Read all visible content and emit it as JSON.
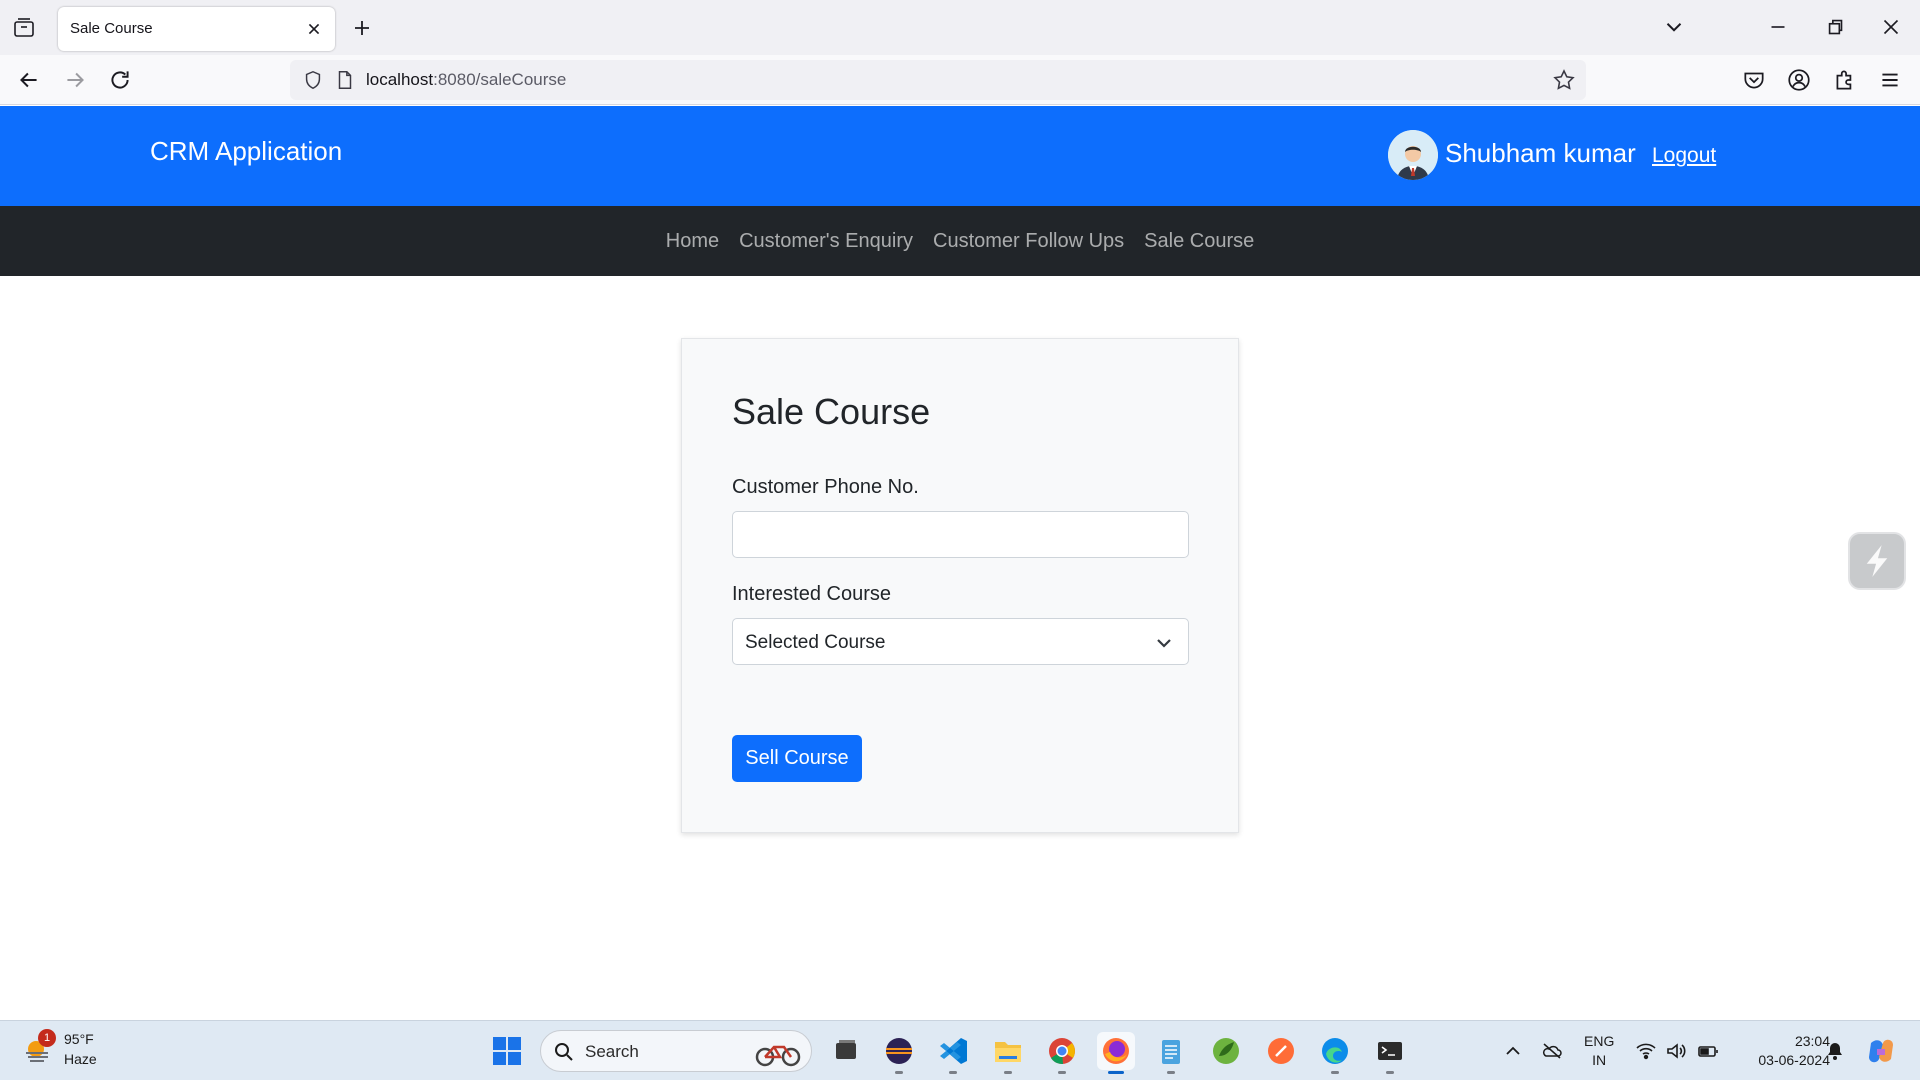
{
  "browser": {
    "tab_title": "Sale Course",
    "url_host": "localhost",
    "url_path": ":8080/saleCourse"
  },
  "header": {
    "brand": "CRM Application",
    "username": "Shubham kumar",
    "logout_label": "Logout"
  },
  "nav": {
    "items": [
      {
        "label": "Home"
      },
      {
        "label": "Customer's Enquiry"
      },
      {
        "label": "Customer Follow Ups"
      },
      {
        "label": "Sale Course"
      }
    ]
  },
  "form": {
    "title": "Sale Course",
    "phone_label": "Customer Phone No.",
    "phone_value": "",
    "course_label": "Interested Course",
    "course_selected": "Selected Course",
    "submit_label": "Sell Course"
  },
  "taskbar": {
    "weather_badge": "1",
    "weather_temp": "95°F",
    "weather_cond": "Haze",
    "search_placeholder": "Search",
    "lang_line1": "ENG",
    "lang_line2": "IN",
    "time": "23:04",
    "date": "03-06-2024"
  },
  "colors": {
    "primary": "#0d6efd",
    "navbar_dark": "#212529",
    "card_bg": "#f8f9fa"
  }
}
